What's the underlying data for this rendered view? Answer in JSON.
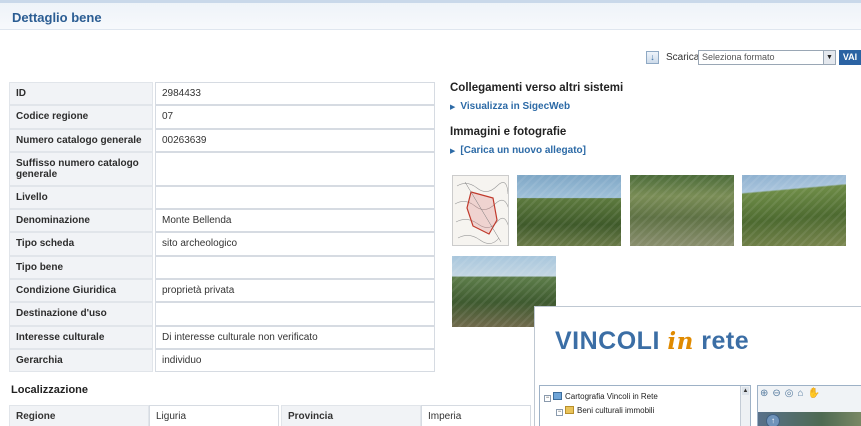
{
  "header": {
    "title": "Dettaglio bene"
  },
  "export": {
    "label": "Scarica",
    "select_value": "Seleziona formato",
    "go_label": "VAI"
  },
  "details": [
    {
      "key": "ID",
      "value": "2984433"
    },
    {
      "key": "Codice regione",
      "value": "07"
    },
    {
      "key": "Numero catalogo generale",
      "value": "00263639"
    },
    {
      "key": "Suffisso numero catalogo generale",
      "value": ""
    },
    {
      "key": "Livello",
      "value": ""
    },
    {
      "key": "Denominazione",
      "value": "Monte Bellenda"
    },
    {
      "key": "Tipo scheda",
      "value": "sito archeologico"
    },
    {
      "key": "Tipo bene",
      "value": ""
    },
    {
      "key": "Condizione Giuridica",
      "value": "proprietà privata"
    },
    {
      "key": "Destinazione d'uso",
      "value": ""
    },
    {
      "key": "Interesse culturale",
      "value": "Di interesse culturale non verificato"
    },
    {
      "key": "Gerarchia",
      "value": "individuo"
    }
  ],
  "links_section": {
    "title": "Collegamenti verso altri sistemi",
    "link": "Visualizza in SigecWeb"
  },
  "images_section": {
    "title": "Immagini e fotografie",
    "upload_link": "[Carica un nuovo allegato]"
  },
  "localization": {
    "title": "Localizzazione",
    "region_label": "Regione",
    "region_value": "Liguria",
    "province_label": "Provincia",
    "province_value": "Imperia"
  },
  "vincoli_popup": {
    "title_a": "VINCOLI",
    "title_in": "in",
    "title_b": "rete",
    "tree": [
      "Cartografia Vincoli in Rete",
      "Beni culturali immobili"
    ]
  }
}
